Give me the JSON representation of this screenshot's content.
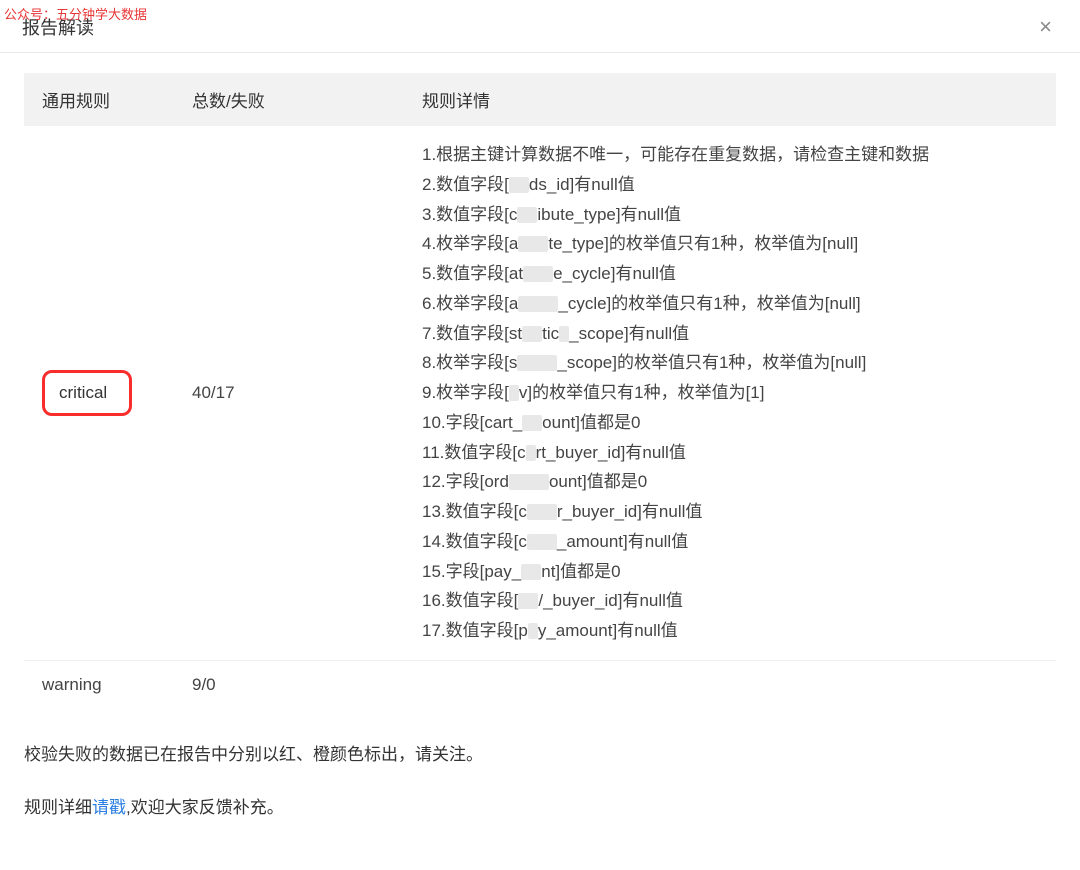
{
  "watermark": "公众号：五分钟学大数据",
  "modal": {
    "title": "报告解读",
    "close_label": "×"
  },
  "table": {
    "headers": {
      "rule": "通用规则",
      "count": "总数/失败",
      "detail": "规则详情"
    },
    "rows": [
      {
        "rule": "critical",
        "highlighted": true,
        "count": "40/17",
        "details": [
          "1.根据主键计算数据不唯一，可能存在重复数据，请检查主键和数据",
          "2.数值字段[▮▮ds_id]有null值",
          "3.数值字段[c▮▮ibute_type]有null值",
          "4.枚举字段[a▮▮▮te_type]的枚举值只有1种，枚举值为[null]",
          "5.数值字段[at▮▮▮e_cycle]有null值",
          "6.枚举字段[a▮▮▮▮_cycle]的枚举值只有1种，枚举值为[null]",
          "7.数值字段[st▮▮tic▮_scope]有null值",
          "8.枚举字段[s▮▮▮▮_scope]的枚举值只有1种，枚举值为[null]",
          "9.枚举字段[▮v]的枚举值只有1种，枚举值为[1]",
          "10.字段[cart_▮▮ount]值都是0",
          "11.数值字段[c▮rt_buyer_id]有null值",
          "12.字段[ord▮▮▮▮ount]值都是0",
          "13.数值字段[c▮▮▮r_buyer_id]有null值",
          "14.数值字段[c▮▮▮_amount]有null值",
          "15.字段[pay_▮▮nt]值都是0",
          "16.数值字段[▮▮/_buyer_id]有null值",
          "17.数值字段[p▮y_amount]有null值"
        ]
      },
      {
        "rule": "warning",
        "highlighted": false,
        "count": "9/0",
        "details": []
      }
    ]
  },
  "footer": {
    "note1": "校验失败的数据已在报告中分别以红、橙颜色标出，请关注。",
    "note2_prefix": "规则详细",
    "note2_link": "请戳",
    "note2_suffix": ",欢迎大家反馈补充。"
  }
}
